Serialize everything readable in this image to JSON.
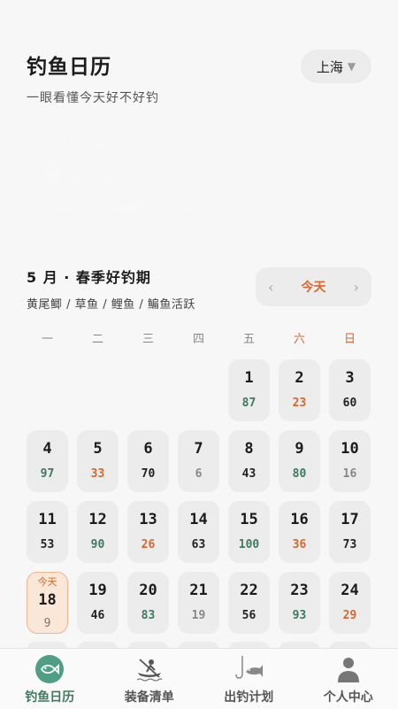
{
  "header": {
    "title": "钓鱼日历",
    "subtitle": "一眼看懂今天好不好钓",
    "city": "上海",
    "city_caret": "▼"
  },
  "score_card": {
    "label": "今日钓鱼指数",
    "score": "9",
    "unit": "分 · 很差",
    "detail": "上海区 阴天 东南风 气压下降"
  },
  "month": {
    "title": "5 月 · 春季好钓期",
    "fish": "黄尾鲫 / 草鱼 / 鲤鱼 / 鳊鱼活跃"
  },
  "nav": {
    "prev": "‹",
    "today": "今天",
    "next": "›"
  },
  "weekdays": [
    "一",
    "二",
    "三",
    "四",
    "五",
    "六",
    "日"
  ],
  "today_tag": "今天",
  "days": [
    {
      "d": "1",
      "s": "87",
      "c": "green"
    },
    {
      "d": "2",
      "s": "23",
      "c": "orange"
    },
    {
      "d": "3",
      "s": "60",
      "c": "black"
    },
    {
      "d": "4",
      "s": "97",
      "c": "green"
    },
    {
      "d": "5",
      "s": "33",
      "c": "orange"
    },
    {
      "d": "6",
      "s": "70",
      "c": "black"
    },
    {
      "d": "7",
      "s": "6",
      "c": "gray"
    },
    {
      "d": "8",
      "s": "43",
      "c": "black"
    },
    {
      "d": "9",
      "s": "80",
      "c": "green"
    },
    {
      "d": "10",
      "s": "16",
      "c": "gray"
    },
    {
      "d": "11",
      "s": "53",
      "c": "black"
    },
    {
      "d": "12",
      "s": "90",
      "c": "green"
    },
    {
      "d": "13",
      "s": "26",
      "c": "orange"
    },
    {
      "d": "14",
      "s": "63",
      "c": "black"
    },
    {
      "d": "15",
      "s": "100",
      "c": "green"
    },
    {
      "d": "16",
      "s": "36",
      "c": "orange"
    },
    {
      "d": "17",
      "s": "73",
      "c": "black"
    },
    {
      "d": "18",
      "s": "9",
      "c": "gray",
      "today": true
    },
    {
      "d": "19",
      "s": "46",
      "c": "black"
    },
    {
      "d": "20",
      "s": "83",
      "c": "green"
    },
    {
      "d": "21",
      "s": "19",
      "c": "gray"
    },
    {
      "d": "22",
      "s": "56",
      "c": "black"
    },
    {
      "d": "23",
      "s": "93",
      "c": "green"
    },
    {
      "d": "24",
      "s": "29",
      "c": "orange"
    }
  ],
  "tabs": [
    {
      "label": "钓鱼日历",
      "icon": "fish-icon",
      "active": true
    },
    {
      "label": "装备清单",
      "icon": "kayak-icon",
      "active": false
    },
    {
      "label": "出钓计划",
      "icon": "hook-fish-icon",
      "active": false
    },
    {
      "label": "个人中心",
      "icon": "person-icon",
      "active": false
    }
  ],
  "colors": {
    "accent_orange": "#d9662c",
    "accent_green": "#3c7a5c",
    "card_bg": "#ececec",
    "today_bg": "#fbe7d8"
  }
}
